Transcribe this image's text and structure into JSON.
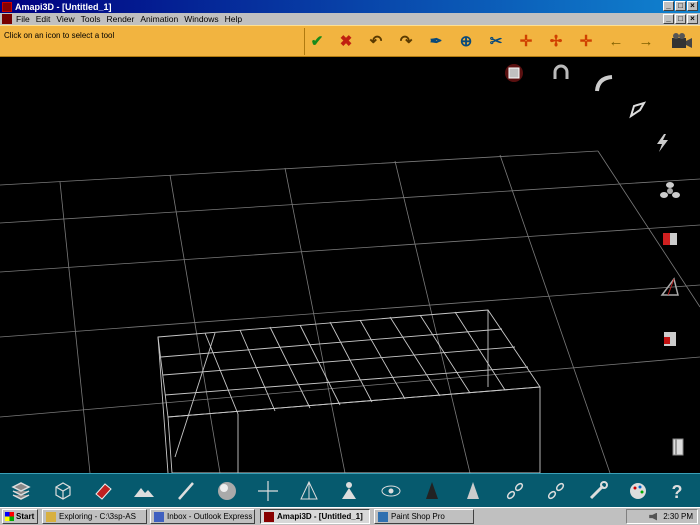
{
  "window": {
    "title": "Amapi3D - [Untitled_1]",
    "buttons": [
      "_",
      "□",
      "×"
    ]
  },
  "menu": {
    "items": [
      "File",
      "Edit",
      "View",
      "Tools",
      "Render",
      "Animation",
      "Windows",
      "Help"
    ],
    "doc_buttons": [
      "_",
      "□",
      "×"
    ]
  },
  "toolstrip": {
    "hint": "Click on an icon to select a tool",
    "icons": [
      "checkmark-icon",
      "cancel-icon",
      "undo-icon",
      "redo-icon",
      "pen-icon",
      "target-icon",
      "scissors-icon",
      "axis-icon",
      "axis-alt-icon",
      "axis-3-icon",
      "arrow-left-icon",
      "arrow-right-icon",
      "camera-icon"
    ]
  },
  "right_palette": [
    "magnet-box-icon",
    "horseshoe-icon",
    "bend-pipe-icon",
    "node-tool-icon",
    "lightning-icon",
    "fan-icon",
    "magnet-icon",
    "triangle-icon",
    "block-icon",
    "book-icon"
  ],
  "bottom_toolbar": [
    "layers-icon",
    "cube-icon",
    "eraser-icon",
    "terrain-icon",
    "brush-icon",
    "sphere-icon",
    "crosshair-icon",
    "cone-light-icon",
    "person-icon",
    "eye-icon",
    "cone-dark-icon",
    "cone-light2-icon",
    "chain-icon",
    "chain2-icon",
    "chain3-icon",
    "wrench-icon",
    "palette-icon",
    "help-icon"
  ],
  "taskbar": {
    "start": "Start",
    "tasks": [
      "Exploring - C:\\3sp-AS",
      "Inbox - Outlook Express",
      "Amapi3D - [Untitled_1]",
      "Paint Shop Pro"
    ],
    "active_index": 2,
    "clock": "2:30 PM"
  }
}
